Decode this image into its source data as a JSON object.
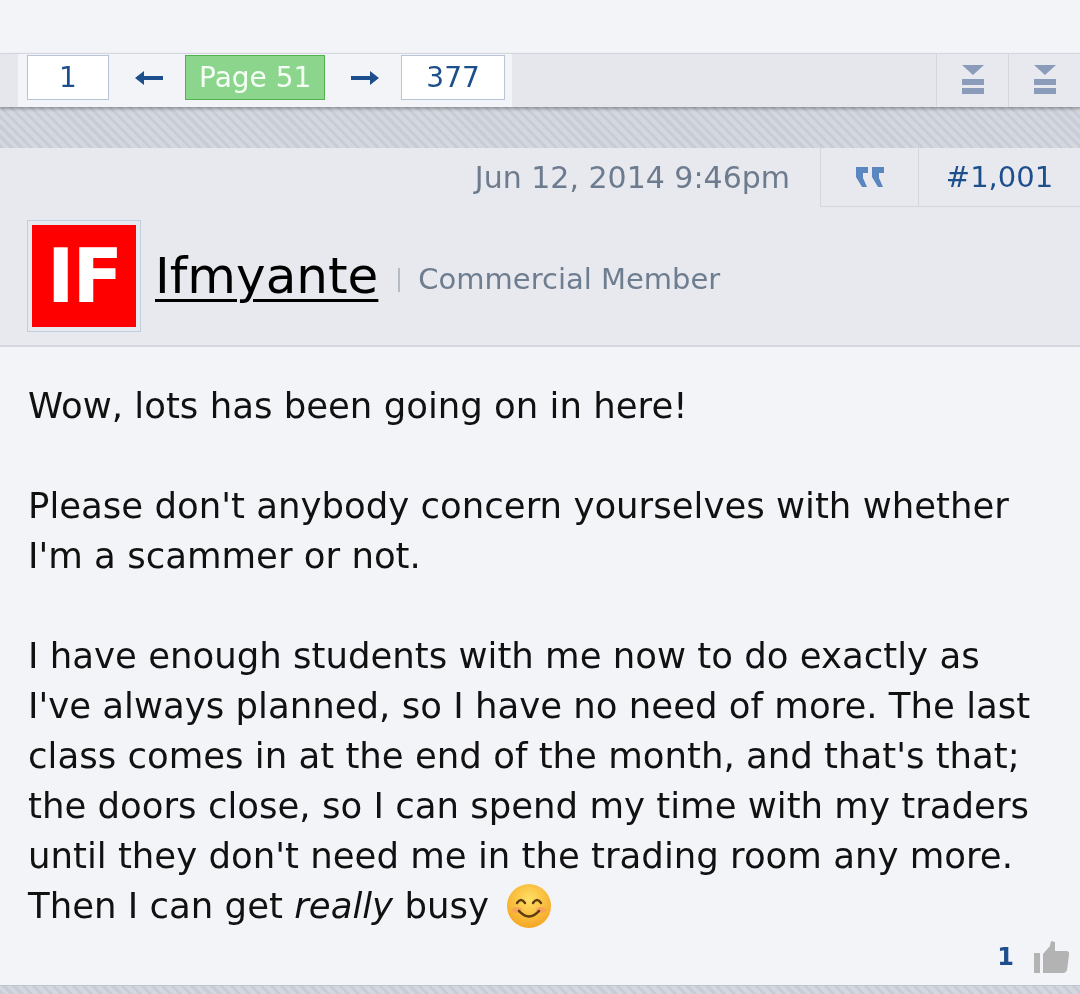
{
  "pagination": {
    "pages": [
      {
        "label": "1",
        "selected": false
      },
      {
        "label": "Page 51",
        "selected": true
      },
      {
        "label": "377",
        "selected": false
      }
    ]
  },
  "post": {
    "date": "Jun 12, 2014 9:46pm",
    "number": "#1,001",
    "author": {
      "avatar_initials": "IF",
      "name": "Ifmyante",
      "title": "Commercial Member"
    },
    "paragraphs": [
      {
        "lines": [
          "Wow, lots has been going on in here!"
        ]
      },
      {
        "lines": [
          "Please don't anybody concern yourselves with whether I'm a scammer or not."
        ]
      },
      {
        "lines": [
          "I have enough students with me now to do exactly as I've always planned, so I have no need of more. The last class comes in at the end of the month, and that's that; the doors close, so I can spend my time with my traders until they don't need me in the trading room any more.",
          "Then I can get *really* busy"
        ]
      }
    ],
    "likes": "1"
  }
}
